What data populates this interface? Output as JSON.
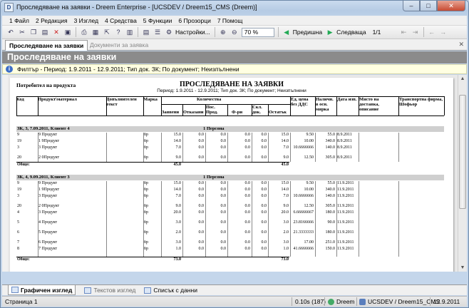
{
  "window": {
    "title": "Проследяване на заявки - Dreem Enterprise - [UCSDEV / Dreem15_CMS (Dreem)]",
    "app_icon": "dreem-icon"
  },
  "menu": [
    "1 Файл",
    "2 Редакция",
    "3 Изглед",
    "4 Средства",
    "5 Функции",
    "6 Прозорци",
    "7 Помощ"
  ],
  "toolbar": {
    "settings_label": "Настройки...",
    "zoom_value": "70 %",
    "prev_label": "Предишна",
    "next_label": "Следваща",
    "page_value": "1/1"
  },
  "tabs": {
    "active": "Проследяване на заявки",
    "inactive": "Документи за заявка"
  },
  "header": {
    "title": "Проследяване на заявки"
  },
  "filter": {
    "text": "Филтър - Период: 1.9.2011 - 12.9.2011; Тип док. ЗК; По документ; Неизпълнени"
  },
  "report": {
    "client_label": "Потребител на продукта",
    "title": "ПРОСЛЕДЯВАНЕ НА ЗАЯВКИ",
    "subtitle": "Период: 1.9.2011 - 12.9.2011; Тип док. ЗК; По документ; Неизпълнени",
    "headers": {
      "code": "Код",
      "product": "Продукт\\материал",
      "extra": "Допълнителен текст",
      "brand": "Марка",
      "qty": "Количества",
      "ordered": "Заявени",
      "cancelled": "Отказани",
      "pos_prod": "Пос. Прод.",
      "fr": "Ф-ри",
      "skl": "Скл. док.",
      "remaining": "Остатък",
      "price": "Ед. цена без ДДС",
      "available": "Наличн. в осн. мярка",
      "date": "Дата изп.",
      "place": "Място на доставка, описание",
      "transport": "Транспортна фирма, Шофьор"
    },
    "groups": [
      {
        "label": "ЗК, 3, 7.09.2011, Клиент 4",
        "person": "1 Персона",
        "rows": [
          {
            "code": "9",
            "product": "9 Продукт",
            "brand": "бр",
            "ordered": "15.0",
            "cancelled": "0.0",
            "pos": "0.0",
            "fr": "0.0",
            "skl": "0.0",
            "rem": "15.0",
            "price": "9.50",
            "avail": "55.0",
            "date": "8.9.2011"
          },
          {
            "code": "19",
            "product": "1 9Продукт",
            "brand": "бр",
            "ordered": "14.0",
            "cancelled": "0.0",
            "pos": "0.0",
            "fr": "0.0",
            "skl": "0.0",
            "rem": "14.0",
            "price": "10.00",
            "avail": "340.0",
            "date": "8.9.2011"
          },
          {
            "code": "3",
            "product": "3 Продукт",
            "brand": "бр",
            "ordered": "7.0",
            "cancelled": "0.0",
            "pos": "0.0",
            "fr": "0.0",
            "skl": "0.0",
            "rem": "7.0",
            "price": "10.6666666",
            "avail": "140.0",
            "date": "8.9.2011"
          },
          {
            "code": "20",
            "product": "2 0Продукт",
            "brand": "бр",
            "ordered": "9.0",
            "cancelled": "0.0",
            "pos": "0.0",
            "fr": "0.0",
            "skl": "0.0",
            "rem": "9.0",
            "price": "12.50",
            "avail": "305.0",
            "date": "8.9.2011"
          }
        ],
        "total_label": "Общо:",
        "total_ordered": "45.0",
        "total_rem": "45.0"
      },
      {
        "label": "ЗК, 4, 9.09.2011, Клиент 3",
        "person": "1 Персона",
        "rows": [
          {
            "code": "9",
            "product": "9 Продукт",
            "brand": "бр",
            "ordered": "15.0",
            "cancelled": "0.0",
            "pos": "0.0",
            "fr": "0.0",
            "skl": "0.0",
            "rem": "15.0",
            "price": "9.50",
            "avail": "55.0",
            "date": "11.9.2011"
          },
          {
            "code": "19",
            "product": "1 9Продукт",
            "brand": "бр",
            "ordered": "14.0",
            "cancelled": "0.0",
            "pos": "0.0",
            "fr": "0.0",
            "skl": "0.0",
            "rem": "14.0",
            "price": "10.00",
            "avail": "340.0",
            "date": "11.9.2011"
          },
          {
            "code": "3",
            "product": "3 Продукт",
            "brand": "бр",
            "ordered": "7.0",
            "cancelled": "0.0",
            "pos": "0.0",
            "fr": "0.0",
            "skl": "0.0",
            "rem": "7.0",
            "price": "10.6666666",
            "avail": "140.0",
            "date": "11.9.2011"
          },
          {
            "code": "20",
            "product": "2 0Продукт",
            "brand": "бр",
            "ordered": "9.0",
            "cancelled": "0.0",
            "pos": "0.0",
            "fr": "0.0",
            "skl": "0.0",
            "rem": "9.0",
            "price": "12.50",
            "avail": "305.0",
            "date": "11.9.2011"
          },
          {
            "code": "4",
            "product": "3 Продукт",
            "brand": "бр",
            "ordered": "20.0",
            "cancelled": "0.0",
            "pos": "0.0",
            "fr": "0.0",
            "skl": "0.0",
            "rem": "20.0",
            "price": "6.66666667",
            "avail": "180.0",
            "date": "11.9.2011"
          },
          {
            "code": "5",
            "product": "4 Продукт",
            "brand": "бр",
            "ordered": "3.0",
            "cancelled": "0.0",
            "pos": "0.0",
            "fr": "0.0",
            "skl": "0.0",
            "rem": "3.0",
            "price": "23.8166666",
            "avail": "90.0",
            "date": "11.9.2011"
          },
          {
            "code": "6",
            "product": "5 Продукт",
            "brand": "бр",
            "ordered": "2.0",
            "cancelled": "0.0",
            "pos": "0.0",
            "fr": "0.0",
            "skl": "0.0",
            "rem": "2.0",
            "price": "21.3333333",
            "avail": "180.0",
            "date": "11.9.2011"
          },
          {
            "code": "7",
            "product": "6 Продукт",
            "brand": "бр",
            "ordered": "3.0",
            "cancelled": "0.0",
            "pos": "0.0",
            "fr": "0.0",
            "skl": "0.0",
            "rem": "3.0",
            "price": "17.00",
            "avail": "251.0",
            "date": "11.9.2011"
          },
          {
            "code": "8",
            "product": "7 Продукт",
            "brand": "бр",
            "ordered": "1.0",
            "cancelled": "0.0",
            "pos": "0.0",
            "fr": "0.0",
            "skl": "0.0",
            "rem": "1.0",
            "price": "41.6666666",
            "avail": "150.0",
            "date": "11.9.2011"
          }
        ],
        "total_label": "Общо:",
        "total_ordered": "73.0",
        "total_rem": "73.0"
      }
    ]
  },
  "bottom_tabs": [
    "Графичен изглед",
    "Текстов изглед",
    "Списък с данни"
  ],
  "status": {
    "page": "Страница 1",
    "time": "0.10s (187)",
    "app": "Dreem",
    "conn": "UCSDEV / Dreem15_CMS",
    "date": "12.9.2011"
  }
}
